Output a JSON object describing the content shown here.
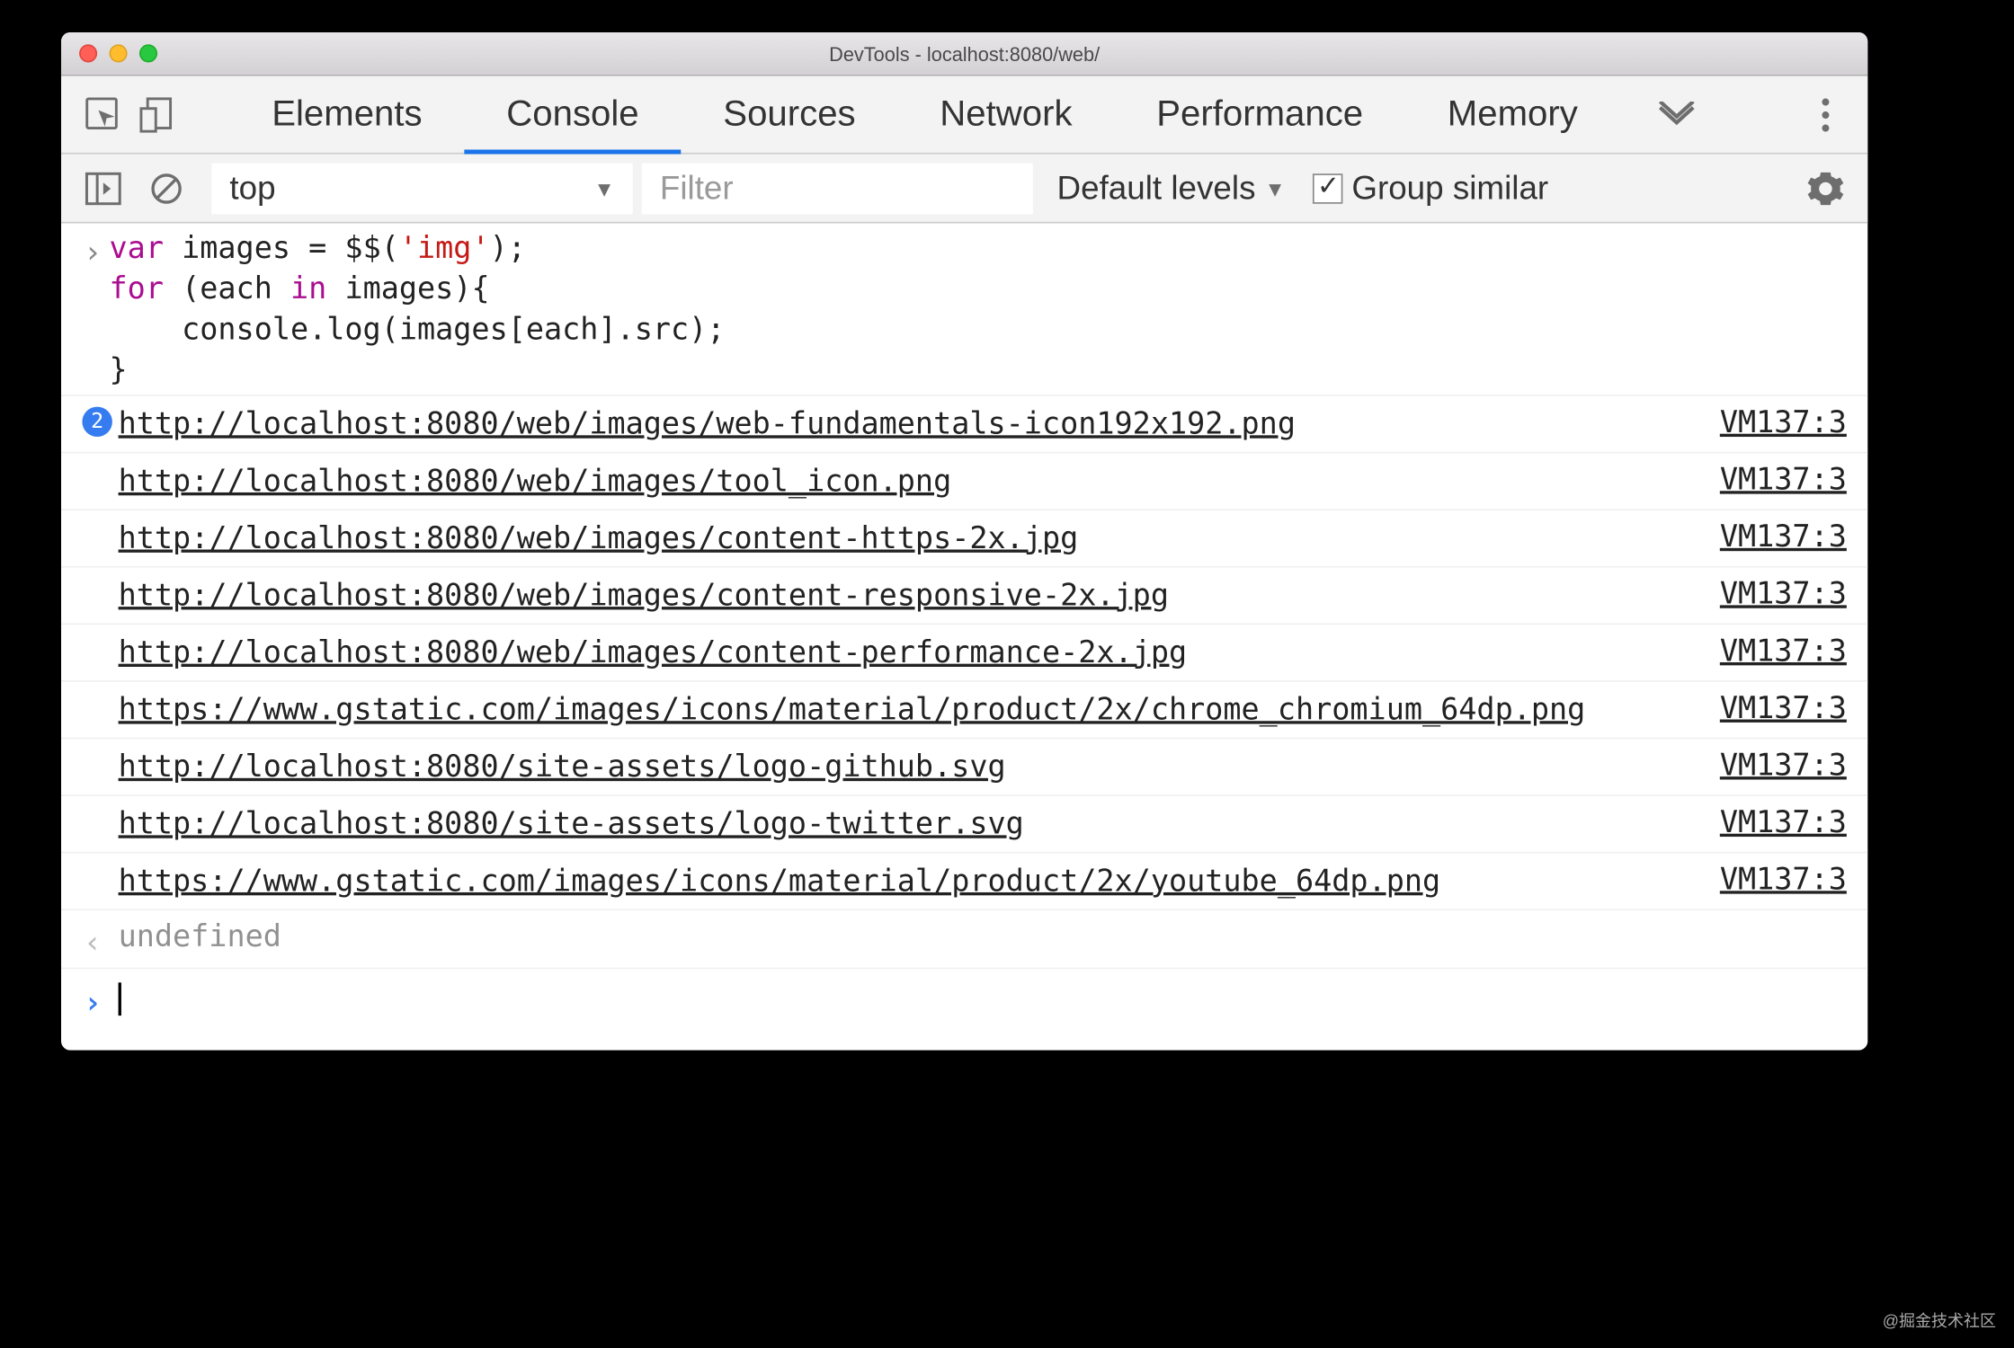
{
  "window": {
    "title": "DevTools - localhost:8080/web/"
  },
  "tabs": {
    "items": [
      "Elements",
      "Console",
      "Sources",
      "Network",
      "Performance",
      "Memory"
    ],
    "active_index": 1
  },
  "toolbar": {
    "context": "top",
    "filter_placeholder": "Filter",
    "levels_label": "Default levels",
    "group_similar_label": "Group similar",
    "group_similar_checked": true
  },
  "code": {
    "line1_kw": "var",
    "line1_rest": " images = $$(",
    "line1_str": "'img'",
    "line1_end": ");",
    "line2_kw1": "for",
    "line2_mid": " (each ",
    "line2_kw2": "in",
    "line2_rest": " images){",
    "line3": "    console.log(images[each].src);",
    "line4": "}"
  },
  "logs": [
    {
      "badge": "2",
      "url": "http://localhost:8080/web/images/web-fundamentals-icon192x192.png",
      "src": "VM137:3"
    },
    {
      "badge": "",
      "url": "http://localhost:8080/web/images/tool_icon.png",
      "src": "VM137:3"
    },
    {
      "badge": "",
      "url": "http://localhost:8080/web/images/content-https-2x.jpg",
      "src": "VM137:3"
    },
    {
      "badge": "",
      "url": "http://localhost:8080/web/images/content-responsive-2x.jpg",
      "src": "VM137:3"
    },
    {
      "badge": "",
      "url": "http://localhost:8080/web/images/content-performance-2x.jpg",
      "src": "VM137:3"
    },
    {
      "badge": "",
      "url": "https://www.gstatic.com/images/icons/material/product/2x/chrome_chromium_64dp.png",
      "src": "VM137:3"
    },
    {
      "badge": "",
      "url": "http://localhost:8080/site-assets/logo-github.svg",
      "src": "VM137:3"
    },
    {
      "badge": "",
      "url": "http://localhost:8080/site-assets/logo-twitter.svg",
      "src": "VM137:3"
    },
    {
      "badge": "",
      "url": "https://www.gstatic.com/images/icons/material/product/2x/youtube_64dp.png",
      "src": "VM137:3"
    }
  ],
  "return_value": "undefined",
  "watermark": "@掘金技术社区"
}
